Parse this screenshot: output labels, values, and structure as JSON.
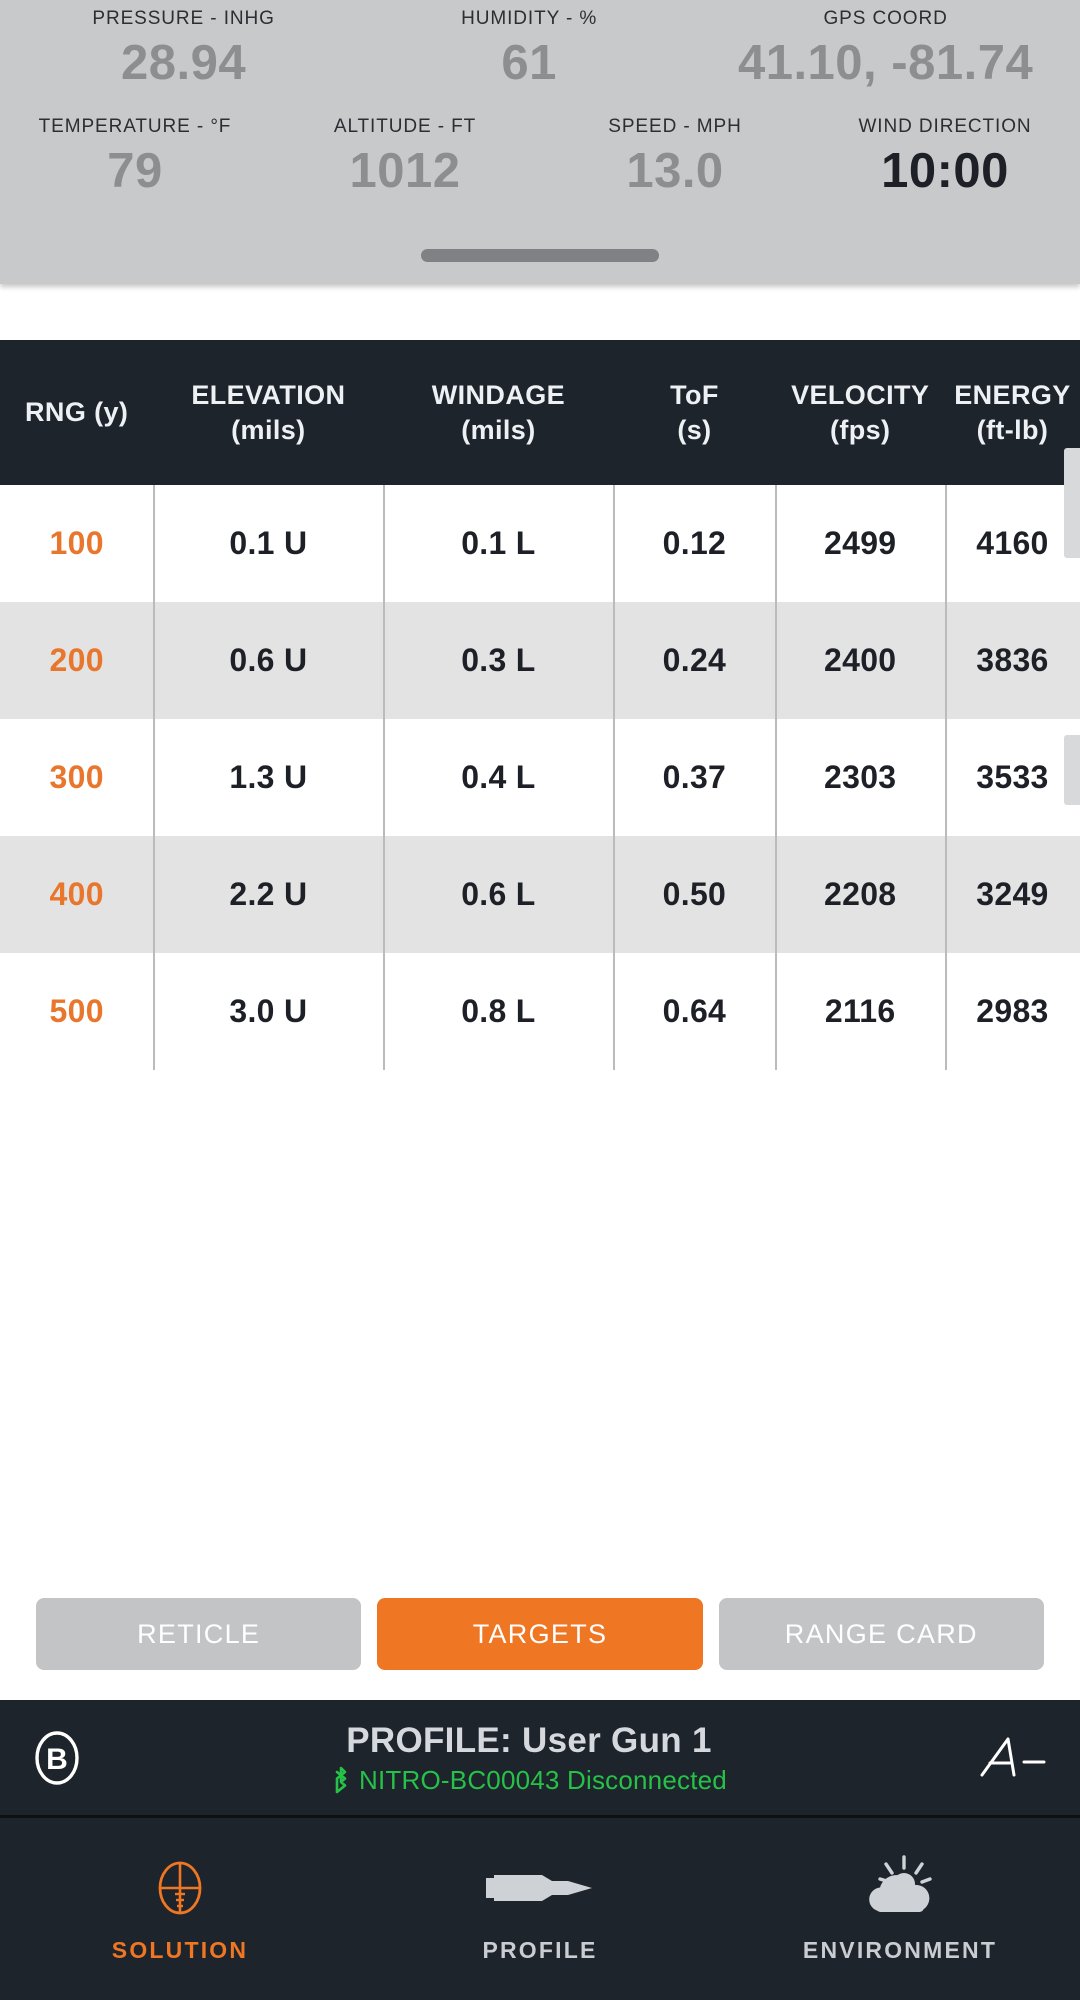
{
  "environment": {
    "metrics_row1": [
      {
        "label": "PRESSURE - INHG",
        "value": "28.94",
        "emphasis": false
      },
      {
        "label": "HUMIDITY - %",
        "value": "61",
        "emphasis": false
      },
      {
        "label": "GPS COORD",
        "value": "41.10, -81.74",
        "emphasis": false
      }
    ],
    "metrics_row2": [
      {
        "label": "TEMPERATURE - °F",
        "value": "79",
        "emphasis": false
      },
      {
        "label": "ALTITUDE - FT",
        "value": "1012",
        "emphasis": false
      },
      {
        "label": "SPEED - MPH",
        "value": "13.0",
        "emphasis": false
      },
      {
        "label": "WIND DIRECTION",
        "value": "10:00",
        "emphasis": true
      }
    ]
  },
  "table": {
    "columns": [
      {
        "name": "RNG",
        "unit": "(y)",
        "inline": true
      },
      {
        "name": "ELEVATION",
        "unit": "(mils)",
        "inline": false
      },
      {
        "name": "WINDAGE",
        "unit": "(mils)",
        "inline": false
      },
      {
        "name": "ToF",
        "unit": "(s)",
        "inline": false
      },
      {
        "name": "VELOCITY",
        "unit": "(fps)",
        "inline": false
      },
      {
        "name": "ENERGY",
        "unit": "(ft-lb)",
        "inline": false
      }
    ],
    "rows": [
      {
        "rng": "100",
        "elevation": "0.1 U",
        "windage": "0.1 L",
        "tof": "0.12",
        "velocity": "2499",
        "energy": "4160"
      },
      {
        "rng": "200",
        "elevation": "0.6 U",
        "windage": "0.3 L",
        "tof": "0.24",
        "velocity": "2400",
        "energy": "3836"
      },
      {
        "rng": "300",
        "elevation": "1.3 U",
        "windage": "0.4 L",
        "tof": "0.37",
        "velocity": "2303",
        "energy": "3533"
      },
      {
        "rng": "400",
        "elevation": "2.2 U",
        "windage": "0.6 L",
        "tof": "0.50",
        "velocity": "2208",
        "energy": "3249"
      },
      {
        "rng": "500",
        "elevation": "3.0 U",
        "windage": "0.8 L",
        "tof": "0.64",
        "velocity": "2116",
        "energy": "2983"
      }
    ]
  },
  "actions": [
    {
      "label": "RETICLE",
      "active": false
    },
    {
      "label": "TARGETS",
      "active": true
    },
    {
      "label": "RANGE CARD",
      "active": false
    }
  ],
  "profile": {
    "title": "PROFILE: User Gun 1",
    "device_status": "NITRO-BC00043 Disconnected",
    "bluetooth_icon": "bluetooth-icon",
    "brand_icon": "ballistic-b-logo",
    "applied_icon": "applied-ballistics-logo"
  },
  "nav": [
    {
      "label": "SOLUTION",
      "icon": "reticle-icon",
      "active": true
    },
    {
      "label": "PROFILE",
      "icon": "cartridge-icon",
      "active": false
    },
    {
      "label": "ENVIRONMENT",
      "icon": "sun-cloud-icon",
      "active": false
    }
  ],
  "colors": {
    "accent_orange": "#ef7622",
    "dark_panel": "#1e242c",
    "status_green": "#25c247",
    "env_panel": "#c8c9ca"
  }
}
